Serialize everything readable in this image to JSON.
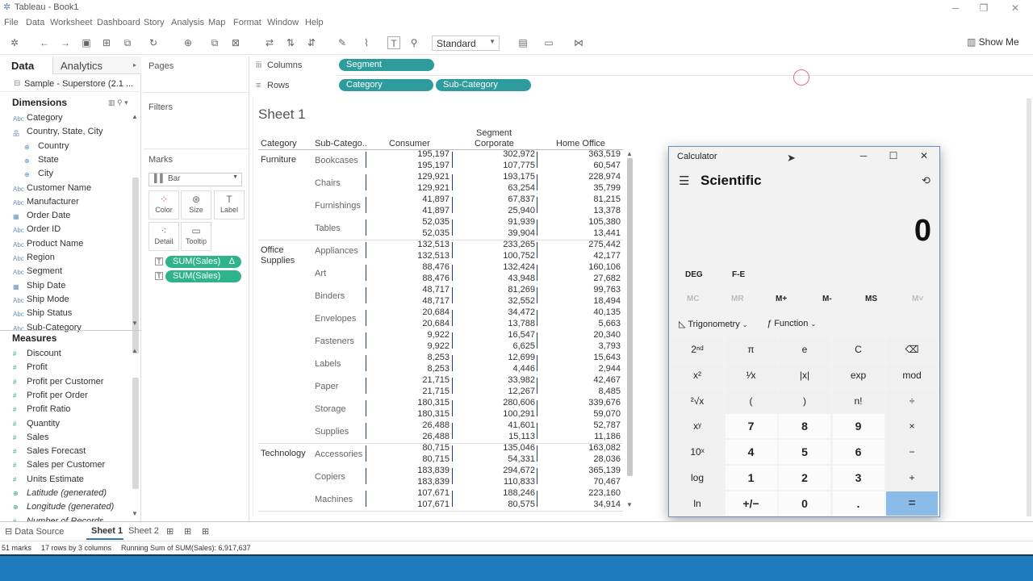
{
  "window": {
    "title": "Tableau - Book1"
  },
  "menu": [
    "File",
    "Data",
    "Worksheet",
    "Dashboard",
    "Story",
    "Analysis",
    "Map",
    "Format",
    "Window",
    "Help"
  ],
  "toolbar": {
    "fit": "Standard",
    "show_me": "Show Me"
  },
  "left_pane": {
    "tab_data": "Data",
    "tab_analytics": "Analytics",
    "datasource": "Sample - Superstore (2.1 ...",
    "dimensions_header": "Dimensions",
    "measures_header": "Measures",
    "dimensions": [
      {
        "label": "Category",
        "icon": "Abc"
      },
      {
        "label": "Country, State, City",
        "icon": "hier"
      },
      {
        "label": "Country",
        "icon": "globe"
      },
      {
        "label": "State",
        "icon": "globe"
      },
      {
        "label": "City",
        "icon": "globe"
      },
      {
        "label": "Customer Name",
        "icon": "Abc"
      },
      {
        "label": "Manufacturer",
        "icon": "Abc"
      },
      {
        "label": "Order Date",
        "icon": "date"
      },
      {
        "label": "Order ID",
        "icon": "Abc"
      },
      {
        "label": "Product Name",
        "icon": "Abc"
      },
      {
        "label": "Region",
        "icon": "Abc"
      },
      {
        "label": "Segment",
        "icon": "Abc"
      },
      {
        "label": "Ship Date",
        "icon": "date"
      },
      {
        "label": "Ship Mode",
        "icon": "Abc"
      },
      {
        "label": "Ship Status",
        "icon": "Abc"
      },
      {
        "label": "Sub-Category",
        "icon": "Abc"
      }
    ],
    "measures": [
      {
        "label": "Discount",
        "italic": false
      },
      {
        "label": "Profit",
        "italic": false
      },
      {
        "label": "Profit per Customer",
        "italic": false
      },
      {
        "label": "Profit per Order",
        "italic": false
      },
      {
        "label": "Profit Ratio",
        "italic": false
      },
      {
        "label": "Quantity",
        "italic": false
      },
      {
        "label": "Sales",
        "italic": false
      },
      {
        "label": "Sales Forecast",
        "italic": false
      },
      {
        "label": "Sales per Customer",
        "italic": false
      },
      {
        "label": "Units Estimate",
        "italic": false
      },
      {
        "label": "Latitude (generated)",
        "italic": true
      },
      {
        "label": "Longitude (generated)",
        "italic": true
      },
      {
        "label": "Number of Records",
        "italic": true
      }
    ]
  },
  "cards": {
    "pages": "Pages",
    "filters": "Filters",
    "marks": "Marks",
    "mark_type": "Bar",
    "mark_buttons": [
      "Color",
      "Size",
      "Label",
      "Detail",
      "Tooltip"
    ],
    "mark_pills": [
      "SUM(Sales)",
      "SUM(Sales)"
    ],
    "delta_symbol": "Δ"
  },
  "shelves": {
    "columns_label": "Columns",
    "rows_label": "Rows",
    "columns": [
      "Segment"
    ],
    "rows": [
      "Category",
      "Sub-Category"
    ]
  },
  "sheet": {
    "title": "Sheet 1",
    "header_segment": "Segment",
    "header_category": "Category",
    "header_subcategory": "Sub-Catego..",
    "segments": [
      "Consumer",
      "Corporate",
      "Home Office"
    ],
    "groups": [
      {
        "category": "Furniture",
        "rows": [
          {
            "sub": "Bookcases",
            "vals": [
              [
                "195,197",
                "195,197"
              ],
              [
                "302,972",
                "107,775"
              ],
              [
                "363,519",
                "60,547"
              ]
            ]
          },
          {
            "sub": "Chairs",
            "vals": [
              [
                "129,921",
                "129,921"
              ],
              [
                "193,175",
                "63,254"
              ],
              [
                "228,974",
                "35,799"
              ]
            ]
          },
          {
            "sub": "Furnishings",
            "vals": [
              [
                "41,897",
                "41,897"
              ],
              [
                "67,837",
                "25,940"
              ],
              [
                "81,215",
                "13,378"
              ]
            ]
          },
          {
            "sub": "Tables",
            "vals": [
              [
                "52,035",
                "52,035"
              ],
              [
                "91,939",
                "39,904"
              ],
              [
                "105,380",
                "13,441"
              ]
            ]
          }
        ]
      },
      {
        "category": "Office Supplies",
        "rows": [
          {
            "sub": "Appliances",
            "vals": [
              [
                "132,513",
                "132,513"
              ],
              [
                "233,265",
                "100,752"
              ],
              [
                "275,442",
                "42,177"
              ]
            ]
          },
          {
            "sub": "Art",
            "vals": [
              [
                "88,476",
                "88,476"
              ],
              [
                "132,424",
                "43,948"
              ],
              [
                "160,106",
                "27,682"
              ]
            ]
          },
          {
            "sub": "Binders",
            "vals": [
              [
                "48,717",
                "48,717"
              ],
              [
                "81,269",
                "32,552"
              ],
              [
                "99,763",
                "18,494"
              ]
            ]
          },
          {
            "sub": "Envelopes",
            "vals": [
              [
                "20,684",
                "20,684"
              ],
              [
                "34,472",
                "13,788"
              ],
              [
                "40,135",
                "5,663"
              ]
            ]
          },
          {
            "sub": "Fasteners",
            "vals": [
              [
                "9,922",
                "9,922"
              ],
              [
                "16,547",
                "6,625"
              ],
              [
                "20,340",
                "3,793"
              ]
            ]
          },
          {
            "sub": "Labels",
            "vals": [
              [
                "8,253",
                "8,253"
              ],
              [
                "12,699",
                "4,446"
              ],
              [
                "15,643",
                "2,944"
              ]
            ]
          },
          {
            "sub": "Paper",
            "vals": [
              [
                "21,715",
                "21,715"
              ],
              [
                "33,982",
                "12,267"
              ],
              [
                "42,467",
                "8,485"
              ]
            ]
          },
          {
            "sub": "Storage",
            "vals": [
              [
                "180,315",
                "180,315"
              ],
              [
                "280,606",
                "100,291"
              ],
              [
                "339,676",
                "59,070"
              ]
            ]
          },
          {
            "sub": "Supplies",
            "vals": [
              [
                "26,488",
                "26,488"
              ],
              [
                "41,601",
                "15,113"
              ],
              [
                "52,787",
                "11,186"
              ]
            ]
          }
        ]
      },
      {
        "category": "Technology",
        "rows": [
          {
            "sub": "Accessories",
            "vals": [
              [
                "80,715",
                "80,715"
              ],
              [
                "135,046",
                "54,331"
              ],
              [
                "163,082",
                "28,036"
              ]
            ]
          },
          {
            "sub": "Copiers",
            "vals": [
              [
                "183,839",
                "183,839"
              ],
              [
                "294,672",
                "110,833"
              ],
              [
                "365,139",
                "70,467"
              ]
            ]
          },
          {
            "sub": "Machines",
            "vals": [
              [
                "107,671",
                "107,671"
              ],
              [
                "188,246",
                "80,575"
              ],
              [
                "223,160",
                "34,914"
              ]
            ]
          }
        ]
      }
    ]
  },
  "bottom_tabs": {
    "datasource": "Data Source",
    "sheets": [
      "Sheet 1",
      "Sheet 2"
    ]
  },
  "status": {
    "marks": "51 marks",
    "rows": "17 rows by 3 columns",
    "sum": "Running Sum of SUM(Sales): 6,917,637"
  },
  "calculator": {
    "title": "Calculator",
    "mode": "Scientific",
    "display": "0",
    "angle": "DEG",
    "fe": "F-E",
    "memory": [
      {
        "label": "MC",
        "enabled": false
      },
      {
        "label": "MR",
        "enabled": false
      },
      {
        "label": "M+",
        "enabled": true
      },
      {
        "label": "M-",
        "enabled": true
      },
      {
        "label": "MS",
        "enabled": true
      },
      {
        "label": "M˅",
        "enabled": false
      }
    ],
    "trig": "Trigonometry",
    "func": "Function",
    "keys": [
      [
        "2ⁿᵈ",
        "π",
        "e",
        "C",
        "⌫"
      ],
      [
        "x²",
        "¹⁄x",
        "|x|",
        "exp",
        "mod"
      ],
      [
        "²√x",
        "(",
        ")",
        "n!",
        "÷"
      ],
      [
        "xʸ",
        "7",
        "8",
        "9",
        "×"
      ],
      [
        "10ˣ",
        "4",
        "5",
        "6",
        "−"
      ],
      [
        "log",
        "1",
        "2",
        "3",
        "+"
      ],
      [
        "ln",
        "+/−",
        "0",
        ".",
        "="
      ]
    ]
  }
}
